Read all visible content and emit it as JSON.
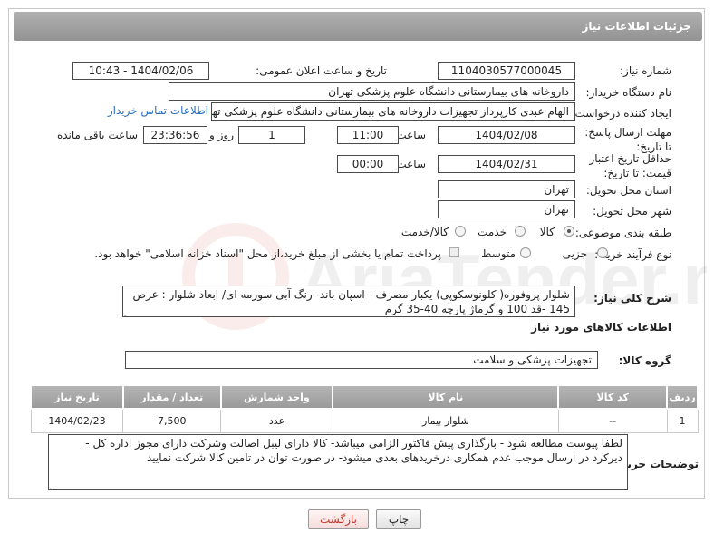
{
  "header": {
    "title": "جزئیات اطلاعات نیاز"
  },
  "fields": {
    "need_number_label": "شماره نیاز:",
    "need_number": "1104030577000045",
    "announce_label": "تاریخ و ساعت اعلان عمومی:",
    "announce_value": "1404/02/06 - 10:43",
    "buyer_org_label": "نام دستگاه خریدار:",
    "buyer_org": "داروخانه های بیمارستانی دانشگاه علوم پزشکی تهران",
    "creator_label": "ایجاد کننده درخواست:",
    "creator": "الهام عبدی کارپرداز تجهیزات داروخانه های بیمارستانی دانشگاه علوم پزشکی تهران",
    "contact_link": "اطلاعات تماس خریدار",
    "deadline_label": "مهلت ارسال پاسخ: تا تاریخ:",
    "deadline_date": "1404/02/08",
    "time_label": "ساعت",
    "deadline_time": "11:00",
    "days_value": "1",
    "days_label": "روز و",
    "remaining_time": "23:36:56",
    "remaining_label": "ساعت باقی مانده",
    "price_validity_label": "حداقل تاریخ اعتبار قیمت: تا تاریخ:",
    "price_date": "1404/02/31",
    "price_time_label": "ساعت",
    "price_time": "00:00",
    "province_label": "استان محل تحویل:",
    "province": "تهران",
    "city_label": "شهر محل تحویل:",
    "city": "تهران",
    "category_label": "طبقه بندی موضوعی:",
    "category_options": [
      "کالا",
      "خدمت",
      "کالا/خدمت"
    ],
    "process_label": "نوع فرآیند خرید :",
    "process_options": [
      "جزیی",
      "متوسط"
    ],
    "payment_note": "پرداخت تمام یا بخشی از مبلغ خرید،از محل \"اسناد خزانه اسلامی\" خواهد بود."
  },
  "description": {
    "label": "شرح کلی نیاز:",
    "text": "شلوار پروفوره( کلونوسکوپی)  یکبار مصرف - اسپان باند -رنگ آبی سورمه ای/ ابعاد شلوار : عرض 145 -قد 100 و گرماژ پارچه 40-35 گرم"
  },
  "goods_section": {
    "title": "اطلاعات کالاهای مورد نیاز",
    "group_label": "گروه کالا:",
    "group_value": "تجهیزات پزشکی و سلامت"
  },
  "table": {
    "headers": [
      "ردیف",
      "کد کالا",
      "نام کالا",
      "واحد شمارش",
      "تعداد / مقدار",
      "تاریخ نیاز"
    ],
    "rows": [
      [
        "1",
        "--",
        "شلوار بیمار",
        "عدد",
        "7,500",
        "1404/02/23"
      ]
    ]
  },
  "buyer_notes": {
    "label": "توضیحات خریدار:",
    "text": "لطفا پیوست مطالعه شود - بارگذاری پیش فاکتور الزامی میباشد- کالا دارای لیبل اصالت وشرکت دارای مجوز اداره کل - دیرکرد در ارسال موجب عدم همکاری درخریدهای بعدی میشود- در صورت توان در تامین کالا شرکت نمایید"
  },
  "buttons": {
    "print": "چاپ",
    "back": "بازگشت"
  },
  "colors": {
    "title_bar": "#a3a3a3",
    "link": "#2a6fbf",
    "back_text": "#c0392b"
  }
}
